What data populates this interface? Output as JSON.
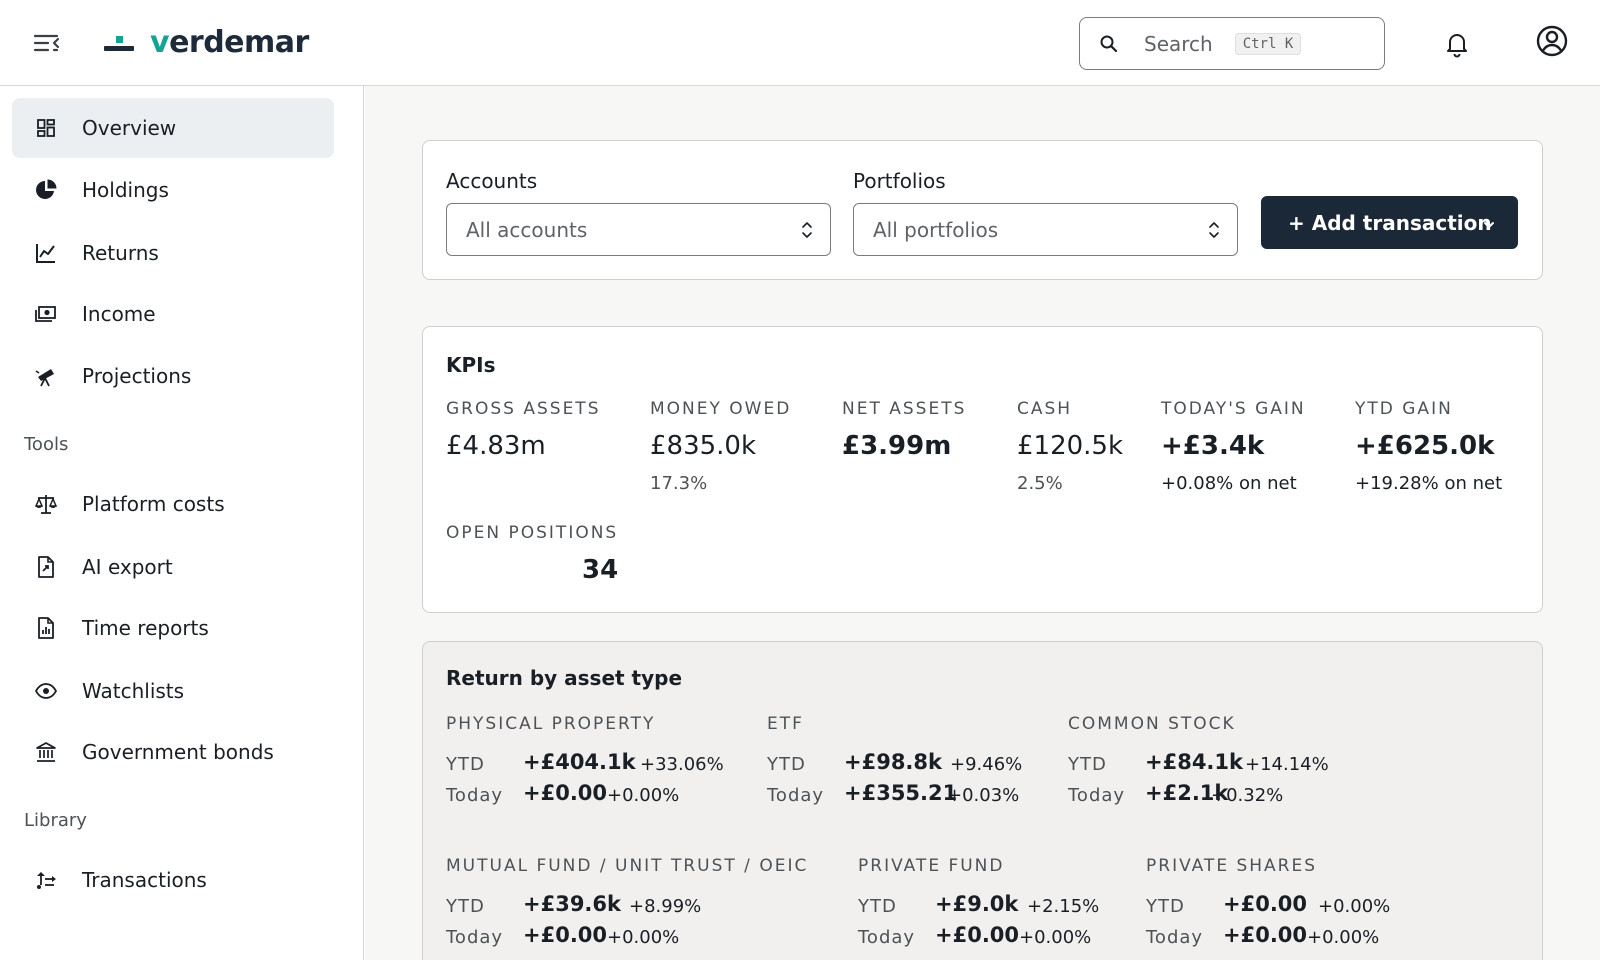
{
  "header": {
    "brand": {
      "prefix": "v",
      "rest": "erdemar"
    },
    "search": {
      "placeholder": "Search",
      "shortcut": "Ctrl K"
    }
  },
  "sidebar": {
    "main_items": [
      {
        "label": "Overview",
        "icon": "dashboard-icon",
        "active": true
      },
      {
        "label": "Holdings",
        "icon": "pie-chart-icon"
      },
      {
        "label": "Returns",
        "icon": "line-chart-icon"
      },
      {
        "label": "Income",
        "icon": "cash-icon"
      },
      {
        "label": "Projections",
        "icon": "telescope-icon"
      }
    ],
    "tools_label": "Tools",
    "tools_items": [
      {
        "label": "Platform costs",
        "icon": "scales-icon"
      },
      {
        "label": "AI export",
        "icon": "file-export-icon"
      },
      {
        "label": "Time reports",
        "icon": "file-chart-icon"
      },
      {
        "label": "Watchlists",
        "icon": "eye-icon"
      },
      {
        "label": "Government bonds",
        "icon": "bank-icon"
      }
    ],
    "library_label": "Library",
    "library_items": [
      {
        "label": "Transactions",
        "icon": "transactions-icon"
      }
    ]
  },
  "filters": {
    "accounts_label": "Accounts",
    "accounts_value": "All accounts",
    "portfolios_label": "Portfolios",
    "portfolios_value": "All portfolios",
    "add_button": "+ Add transaction"
  },
  "kpis": {
    "title": "KPIs",
    "items": [
      {
        "label": "GROSS ASSETS",
        "value": "£4.83m",
        "sub": ""
      },
      {
        "label": "MONEY OWED",
        "value": "£835.0k",
        "sub": "17.3%"
      },
      {
        "label": "NET ASSETS",
        "value": "£3.99m",
        "sub": ""
      },
      {
        "label": "CASH",
        "value": "£120.5k",
        "sub": "2.5%"
      },
      {
        "label": "TODAY'S GAIN",
        "value": "+£3.4k",
        "sub": "+0.08% on net"
      },
      {
        "label": "YTD GAIN",
        "value": "+£625.0k",
        "sub": "+19.28% on net"
      }
    ],
    "open_positions": {
      "label": "OPEN POSITIONS",
      "value": "34"
    }
  },
  "returns": {
    "title": "Return by asset type",
    "period_ytd": "YTD",
    "period_today": "Today",
    "assets": [
      {
        "name": "PHYSICAL PROPERTY",
        "ytd_amount": "+£404.1k",
        "ytd_pct": "+33.06%",
        "today_amount": "+£0.00",
        "today_pct": "+0.00%"
      },
      {
        "name": "ETF",
        "ytd_amount": "+£98.8k",
        "ytd_pct": "+9.46%",
        "today_amount": "+£355.21",
        "today_pct": "+0.03%"
      },
      {
        "name": "COMMON STOCK",
        "ytd_amount": "+£84.1k",
        "ytd_pct": "+14.14%",
        "today_amount": "+£2.1k",
        "today_pct": "+0.32%"
      },
      {
        "name": "MUTUAL FUND / UNIT TRUST / OEIC",
        "ytd_amount": "+£39.6k",
        "ytd_pct": "+8.99%",
        "today_amount": "+£0.00",
        "today_pct": "+0.00%"
      },
      {
        "name": "PRIVATE FUND",
        "ytd_amount": "+£9.0k",
        "ytd_pct": "+2.15%",
        "today_amount": "+£0.00",
        "today_pct": "+0.00%"
      },
      {
        "name": "PRIVATE SHARES",
        "ytd_amount": "+£0.00",
        "ytd_pct": "+0.00%",
        "today_amount": "+£0.00",
        "today_pct": "+0.00%"
      }
    ]
  },
  "colors": {
    "brand_dark": "#1d2a3a",
    "brand_teal": "#16a394",
    "button_dark": "#1b2838",
    "active_nav_bg": "#eceff1"
  }
}
